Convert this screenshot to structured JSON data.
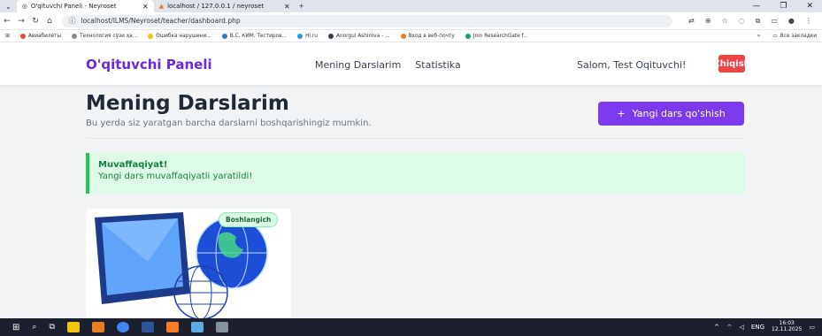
{
  "browser": {
    "tabs": [
      {
        "title": "O'qituvchi Paneli - Neyroset",
        "active": true
      },
      {
        "title": "localhost / 127.0.0.1 / neyroset",
        "active": false
      }
    ],
    "new_tab_label": "+",
    "url": "localhost/ILMS/Neyroset/teacher/dashboard.php",
    "bookmarks": [
      {
        "label": "Авиабилеты",
        "color": "#e74c3c"
      },
      {
        "label": "Технология cўзи ҳа...",
        "color": "#7f8c8d"
      },
      {
        "label": "Ошибка нарушени...",
        "color": "#f1c40f"
      },
      {
        "label": "В.С. КИМ. Тестиров...",
        "color": "#2980b9"
      },
      {
        "label": "Hi.ru",
        "color": "#3498db"
      },
      {
        "label": "Anorgul Ashirova - ...",
        "color": "#2c3e50"
      },
      {
        "label": "Вход в веб-почту",
        "color": "#e67e22"
      },
      {
        "label": "Join ResearchGate f...",
        "color": "#16a085"
      }
    ],
    "bookmarks_more": "»",
    "all_bookmarks": "Все закладки"
  },
  "header": {
    "brand": "O'qituvchi Paneli",
    "nav": [
      "Mening Darslarim",
      "Statistika"
    ],
    "greeting": "Salom, Test Oqituvchi!",
    "logout": "Chiqish"
  },
  "main": {
    "title": "Mening Darslarim",
    "subtitle": "Bu yerda siz yaratgan barcha darslarni boshqarishingiz mumkin.",
    "add_button": "Yangi dars qo'shish",
    "add_icon": "+"
  },
  "alert": {
    "title": "Muvaffaqiyat!",
    "message": "Yangi dars muvaffaqiyatli yaratildi!"
  },
  "lesson_cards": [
    {
      "level": "Boshlangich"
    }
  ],
  "taskbar": {
    "lang": "ENG",
    "time": "16:03",
    "date": "12.11.2025"
  },
  "colors": {
    "brand": "#6d28d9",
    "primary": "#7c3aed",
    "danger": "#ef4444",
    "success": "#22c55e"
  }
}
